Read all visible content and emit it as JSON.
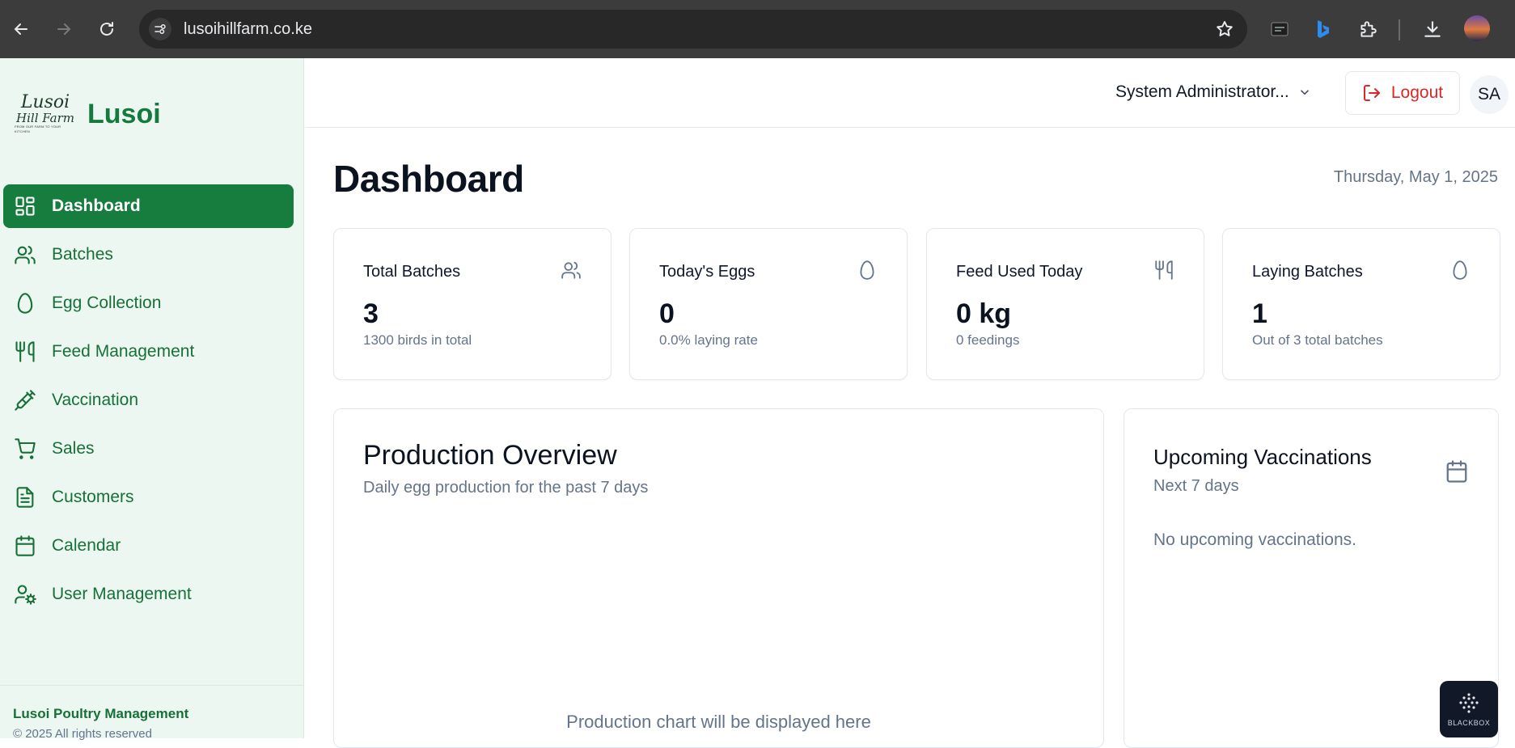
{
  "browser": {
    "url": "lusoihillfarm.co.ke"
  },
  "brand": {
    "logo_line1": "Lusoi",
    "logo_line2": "Hill Farm",
    "logo_tagline": "FROM OUR FARM TO YOUR KITCHEN",
    "name": "Lusoi",
    "color": "#157a3e"
  },
  "sidebar": {
    "items": [
      {
        "label": "Dashboard",
        "icon": "dashboard-icon",
        "active": true
      },
      {
        "label": "Batches",
        "icon": "users-icon",
        "active": false
      },
      {
        "label": "Egg Collection",
        "icon": "egg-icon",
        "active": false
      },
      {
        "label": "Feed Management",
        "icon": "utensils-icon",
        "active": false
      },
      {
        "label": "Vaccination",
        "icon": "syringe-icon",
        "active": false
      },
      {
        "label": "Sales",
        "icon": "cart-icon",
        "active": false
      },
      {
        "label": "Customers",
        "icon": "document-icon",
        "active": false
      },
      {
        "label": "Calendar",
        "icon": "calendar-icon",
        "active": false
      },
      {
        "label": "User Management",
        "icon": "user-cog-icon",
        "active": false
      }
    ],
    "footer_title": "Lusoi Poultry Management",
    "footer_copyright": "© 2025 All rights reserved"
  },
  "header": {
    "user_role": "System Administrator...",
    "logout_label": "Logout",
    "avatar_initials": "SA"
  },
  "page": {
    "title": "Dashboard",
    "date": "Thursday, May 1, 2025"
  },
  "stats": [
    {
      "title": "Total Batches",
      "value": "3",
      "subtitle": "1300 birds in total",
      "icon": "users-icon"
    },
    {
      "title": "Today's Eggs",
      "value": "0",
      "subtitle": "0.0% laying rate",
      "icon": "egg-icon"
    },
    {
      "title": "Feed Used Today",
      "value": "0 kg",
      "subtitle": "0 feedings",
      "icon": "utensils-icon"
    },
    {
      "title": "Laying Batches",
      "value": "1",
      "subtitle": "Out of 3 total batches",
      "icon": "egg-icon"
    }
  ],
  "production": {
    "title": "Production Overview",
    "subtitle": "Daily egg production for the past 7 days",
    "placeholder": "Production chart will be displayed here"
  },
  "vaccinations": {
    "title": "Upcoming Vaccinations",
    "subtitle": "Next 7 days",
    "empty": "No upcoming vaccinations."
  },
  "widget": {
    "label": "BLACKBOX"
  },
  "colors": {
    "accent": "#177d3e",
    "sidebar_bg": "#edf7f1",
    "logout": "#dc2626"
  }
}
